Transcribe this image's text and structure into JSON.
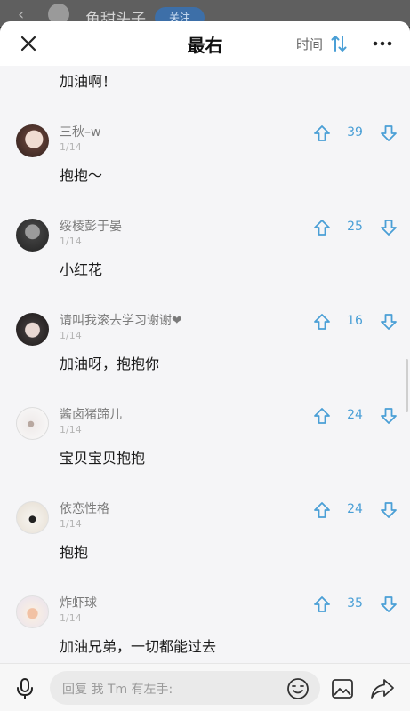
{
  "behind": {
    "back": "‹",
    "name": "鱼甜头子",
    "follow": "关注"
  },
  "header": {
    "title": "最右",
    "sort_label": "时间"
  },
  "first_body": "加油啊！",
  "comments": [
    {
      "name": "三秋–w",
      "date": "1/14",
      "body": "抱抱～",
      "votes": "39"
    },
    {
      "name": "绥棱彭于晏",
      "date": "1/14",
      "body": "小红花",
      "votes": "25"
    },
    {
      "name": "请叫我滚去学习谢谢❤",
      "date": "1/14",
      "body": "加油呀，抱抱你",
      "votes": "16"
    },
    {
      "name": "酱卤猪蹄儿",
      "date": "1/14",
      "body": "宝贝宝贝抱抱",
      "votes": "24"
    },
    {
      "name": "依恋性格",
      "date": "1/14",
      "body": "抱抱",
      "votes": "24"
    },
    {
      "name": "炸虾球",
      "date": "1/14",
      "body": "加油兄弟，一切都能过去",
      "votes": "35"
    }
  ],
  "input": {
    "placeholder": "回复 我 Tm 有左手:"
  },
  "colors": {
    "accent": "#4a9fd6",
    "background": "#f5f5f7"
  }
}
